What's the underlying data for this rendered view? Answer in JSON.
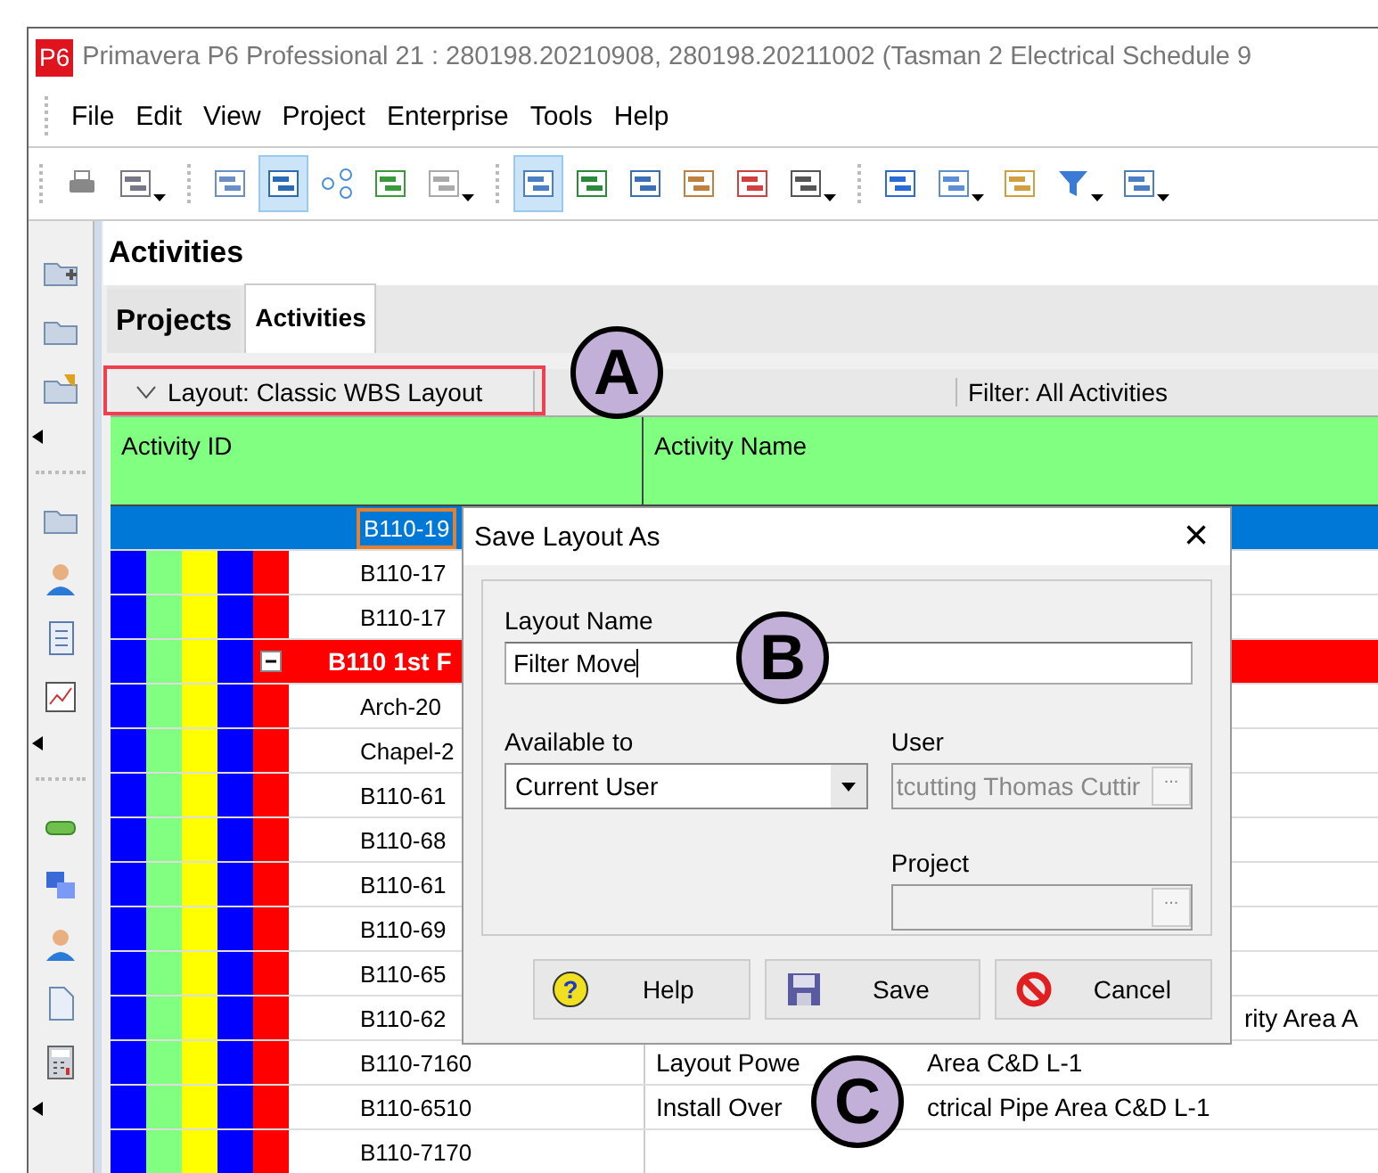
{
  "window": {
    "logo": "P6",
    "title": "Primavera P6 Professional 21 : 280198.20210908, 280198.20211002 (Tasman 2 Electrical Schedule 9"
  },
  "menu": [
    "File",
    "Edit",
    "View",
    "Project",
    "Enterprise",
    "Tools",
    "Help"
  ],
  "toolbar": [
    [
      {
        "selected": false,
        "dropdown": false
      },
      {
        "selected": false,
        "dropdown": true
      }
    ],
    [
      {
        "selected": false,
        "dropdown": false
      },
      {
        "selected": true,
        "dropdown": false
      },
      {
        "selected": false,
        "dropdown": false
      },
      {
        "selected": false,
        "dropdown": false
      },
      {
        "selected": false,
        "dropdown": true
      }
    ],
    [
      {
        "selected": true,
        "dropdown": false
      },
      {
        "selected": false,
        "dropdown": false
      },
      {
        "selected": false,
        "dropdown": false
      },
      {
        "selected": false,
        "dropdown": false
      },
      {
        "selected": false,
        "dropdown": false
      },
      {
        "selected": false,
        "dropdown": true
      }
    ],
    [
      {
        "selected": false,
        "dropdown": false
      },
      {
        "selected": false,
        "dropdown": true
      },
      {
        "selected": false,
        "dropdown": false
      },
      {
        "selected": false,
        "dropdown": true
      },
      {
        "selected": false,
        "dropdown": true
      }
    ]
  ],
  "panel": {
    "title": "Activities"
  },
  "tabs": [
    {
      "label": "Projects",
      "selected": false
    },
    {
      "label": "Activities",
      "selected": true
    }
  ],
  "layout_bar": {
    "layout": "Layout: Classic WBS Layout",
    "filter": "Filter: All Activities"
  },
  "table": {
    "bands": [
      {
        "color": "#0000ff"
      },
      {
        "color": "#80ff80"
      },
      {
        "color": "#ffff00"
      },
      {
        "color": "#0000ff"
      },
      {
        "color": "#ff0000"
      }
    ],
    "columns": [
      "Activity ID",
      "Activity Name"
    ],
    "rows": [
      {
        "kind": "activity",
        "id": "B110-19",
        "selected": true
      },
      {
        "kind": "activity",
        "id": "B110-17",
        "selected": false
      },
      {
        "kind": "activity",
        "id": "B110-17",
        "selected": false
      },
      {
        "kind": "wbs",
        "id": "B110 1st F",
        "color": "#ff0000",
        "expanded": true,
        "selected": false
      },
      {
        "kind": "activity",
        "id": "Arch-20",
        "selected": false
      },
      {
        "kind": "activity",
        "id": "Chapel-2",
        "selected": false
      },
      {
        "kind": "activity",
        "id": "B110-61",
        "selected": false
      },
      {
        "kind": "activity",
        "id": "B110-68",
        "selected": false
      },
      {
        "kind": "activity",
        "id": "B110-61",
        "selected": false
      },
      {
        "kind": "activity",
        "id": "B110-69",
        "selected": false
      },
      {
        "kind": "activity",
        "id": "B110-65",
        "selected": false
      },
      {
        "kind": "activity",
        "id": "B110-62",
        "name_right": "rity Area A",
        "selected": false
      },
      {
        "kind": "activity",
        "id": "B110-7160",
        "name_left": "Layout Powe",
        "name_mid": "Area C&D L-1",
        "selected": false
      },
      {
        "kind": "activity",
        "id": "B110-6510",
        "name_left": "Install Over",
        "name_mid": "ctrical Pipe Area C&D L-1",
        "selected": false
      },
      {
        "kind": "activity",
        "id": "B110-7170",
        "selected": false
      }
    ]
  },
  "dialog": {
    "title": "Save Layout As",
    "close": "×",
    "layout_name_label": "Layout Name",
    "layout_name": "Filter Move",
    "available_label": "Available to",
    "available": "Current User",
    "user_label": "User",
    "user": "tcutting Thomas Cuttir",
    "user_button": "...",
    "project_label": "Project",
    "project_button": "...",
    "buttons": [
      {
        "kind": "help",
        "label": "Help",
        "icon": "?"
      },
      {
        "kind": "save",
        "label": "Save"
      },
      {
        "kind": "cancel",
        "label": "Cancel"
      }
    ]
  },
  "annotations": [
    {
      "label": "A"
    },
    {
      "label": "B"
    },
    {
      "label": "C"
    }
  ]
}
